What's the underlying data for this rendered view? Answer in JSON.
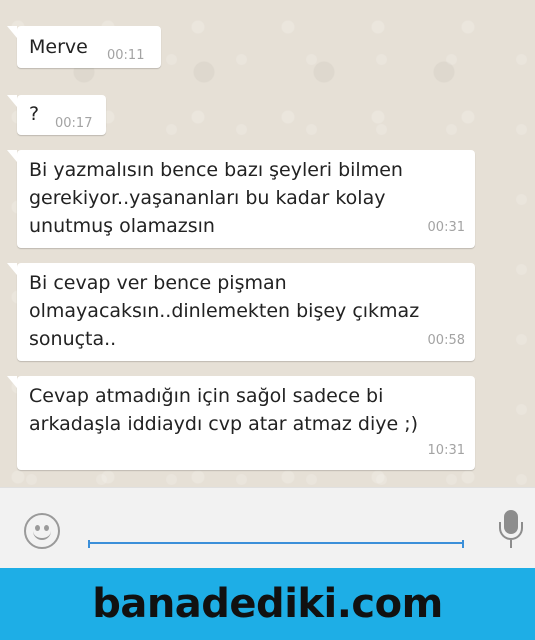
{
  "messages": [
    {
      "text": "Merve",
      "time": "00:11"
    },
    {
      "text": "?",
      "time": "00:17"
    },
    {
      "text": "Bi yazmalısın bence bazı şeyleri bilmen\ngerekiyor..yaşananları bu kadar kolay\nunutmuş olamazsın",
      "time": "00:31"
    },
    {
      "text": "Bi cevap ver bence pişman\nolmayacaksın..dinlemekten bişey çıkmaz\nsonuçta..",
      "time": "00:58"
    },
    {
      "text": "Cevap atmadığın için sağol sadece bi\narkadaşla iddiaydı cvp atar atmaz diye ;)",
      "time": "10:31"
    }
  ],
  "composer": {
    "emoji_icon": "smiley-icon",
    "mic_icon": "microphone-icon",
    "input_value": "",
    "accent_color": "#3b8fd9"
  },
  "watermark": {
    "text": "banadediki.com",
    "background": "#1eaee6"
  }
}
